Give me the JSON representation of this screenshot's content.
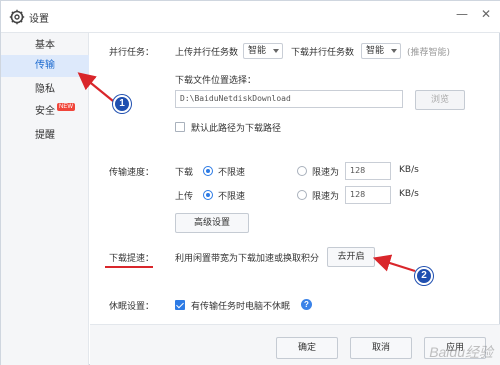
{
  "window": {
    "title": "设置",
    "title_icon": "gear-icon",
    "controls": {
      "min": "—",
      "close": "✕"
    }
  },
  "sidebar": {
    "items": [
      {
        "label": "基本"
      },
      {
        "label": "传输",
        "active": true
      },
      {
        "label": "隐私"
      },
      {
        "label": "安全",
        "badge": "NEW"
      },
      {
        "label": "提醒"
      }
    ]
  },
  "parallel": {
    "label": "并行任务：",
    "upload_label": "上传并行任务数",
    "upload_value": "智能",
    "download_label": "下载并行任务数",
    "download_value": "智能",
    "hint": "(推荐智能)"
  },
  "download_path": {
    "label": "下载文件位置选择：",
    "value": "D:\\BaiduNetdiskDownload",
    "browse_label": "浏览",
    "default_label": "默认此路径为下载路径"
  },
  "speed": {
    "label": "传输速度：",
    "download": {
      "label": "下载",
      "unlimited": "不限速",
      "limit": "限速为",
      "value": "128",
      "unit": "KB/s"
    },
    "upload": {
      "label": "上传",
      "unlimited": "不限速",
      "limit": "限速为",
      "value": "128",
      "unit": "KB/s"
    },
    "advanced_label": "高级设置"
  },
  "accelerate": {
    "label": "下载提速：",
    "description": "利用闲置带宽为下载加速或换取积分",
    "button_label": "去开启"
  },
  "sleep": {
    "label": "休眠设置：",
    "checkbox_label": "有传输任务时电脑不休眠",
    "checked": true
  },
  "footer": {
    "ok": "确定",
    "cancel": "取消",
    "apply": "应用"
  },
  "annotations": {
    "badge1": "1",
    "badge2": "2",
    "color": "#d9262b"
  },
  "watermark": "Baidu经验"
}
